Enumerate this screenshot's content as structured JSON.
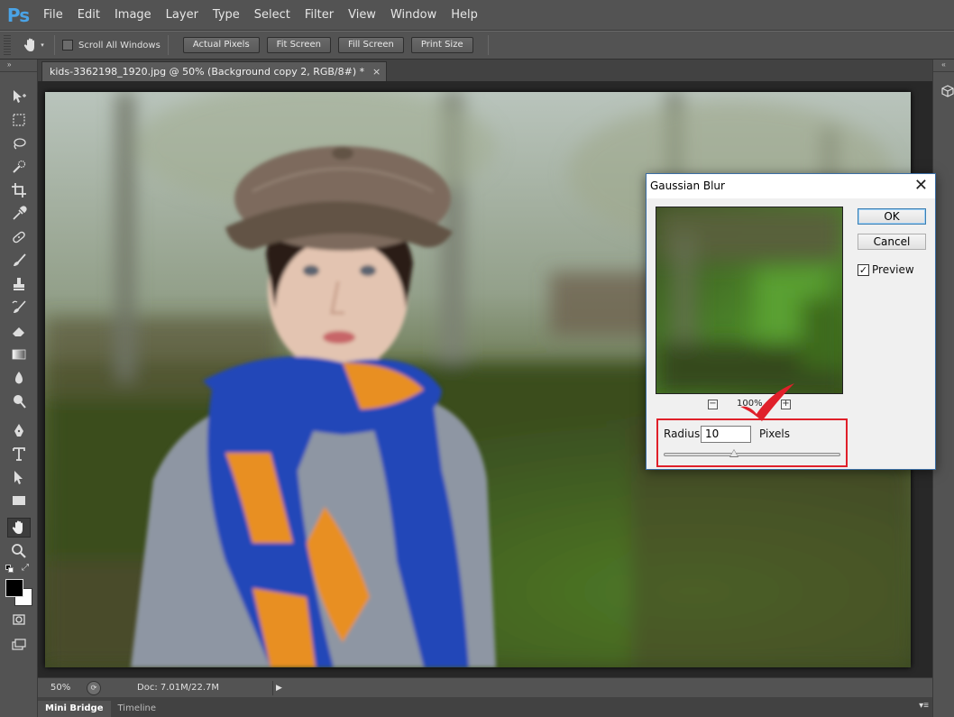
{
  "app": {
    "logo": "Ps"
  },
  "menu": [
    "File",
    "Edit",
    "Image",
    "Layer",
    "Type",
    "Select",
    "Filter",
    "View",
    "Window",
    "Help"
  ],
  "options": {
    "scroll_all_windows": "Scroll All Windows",
    "scroll_all_checked": false,
    "buttons": [
      "Actual Pixels",
      "Fit Screen",
      "Fill Screen",
      "Print Size"
    ]
  },
  "document": {
    "tab_title": "kids-3362198_1920.jpg @ 50% (Background copy 2, RGB/8#) *",
    "close": "×"
  },
  "status": {
    "zoom": "50%",
    "doc_size": "Doc: 7.01M/22.7M"
  },
  "bottom_tabs": [
    "Mini Bridge",
    "Timeline"
  ],
  "dialog": {
    "title": "Gaussian Blur",
    "ok": "OK",
    "cancel": "Cancel",
    "preview_label": "Preview",
    "preview_checked": true,
    "zoom_out": "−",
    "zoom_in": "+",
    "zoom_percent": "100%",
    "radius_label": "Radius:",
    "radius_value": "10",
    "radius_unit": "Pixels",
    "radius_slider_fraction": 0.4
  },
  "colors": {
    "accent_red": "#e0202a",
    "ps_blue": "#4aa3e6"
  }
}
